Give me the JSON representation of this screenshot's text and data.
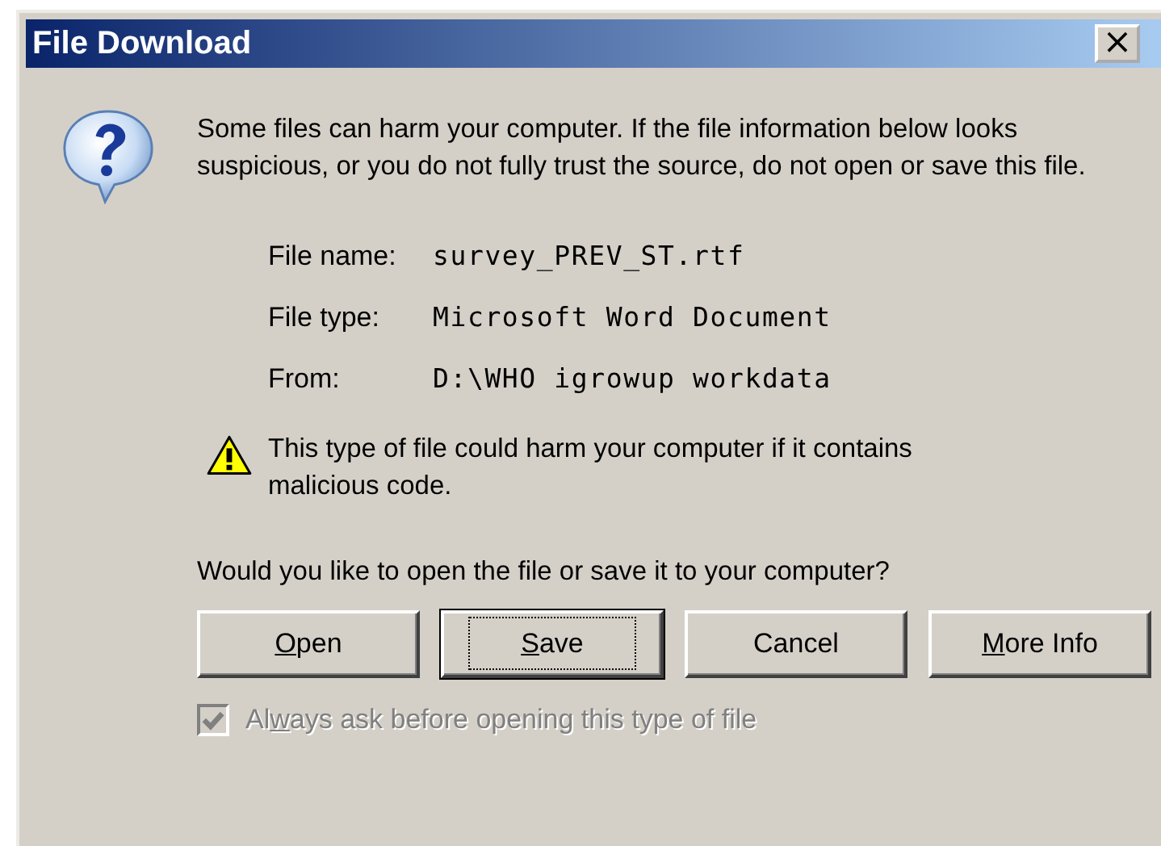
{
  "window": {
    "title": "File Download",
    "close": "×"
  },
  "message": "Some files can harm your computer. If the file information below looks suspicious, or you do not fully trust the source, do not open or save this file.",
  "details": [
    {
      "label": "File name:",
      "value": "survey_PREV_ST.rtf"
    },
    {
      "label": "File type:",
      "value": "Microsoft Word Document"
    },
    {
      "label": "From:",
      "value": "D:\\WHO igrowup workdata"
    }
  ],
  "warning": "This type of file could harm your computer if it contains malicious code.",
  "question": "Would you like to open the file or save it to your computer?",
  "buttons": [
    {
      "key": "O",
      "after": "pen",
      "default": false
    },
    {
      "key": "S",
      "after": "ave",
      "default": true
    },
    {
      "before": "Cancel",
      "default": false
    },
    {
      "key": "M",
      "after": "ore Info",
      "default": false
    }
  ],
  "checkbox": {
    "before": "Al",
    "key": "w",
    "after": "ays ask before opening this type of file",
    "checked": true,
    "disabled": true
  }
}
